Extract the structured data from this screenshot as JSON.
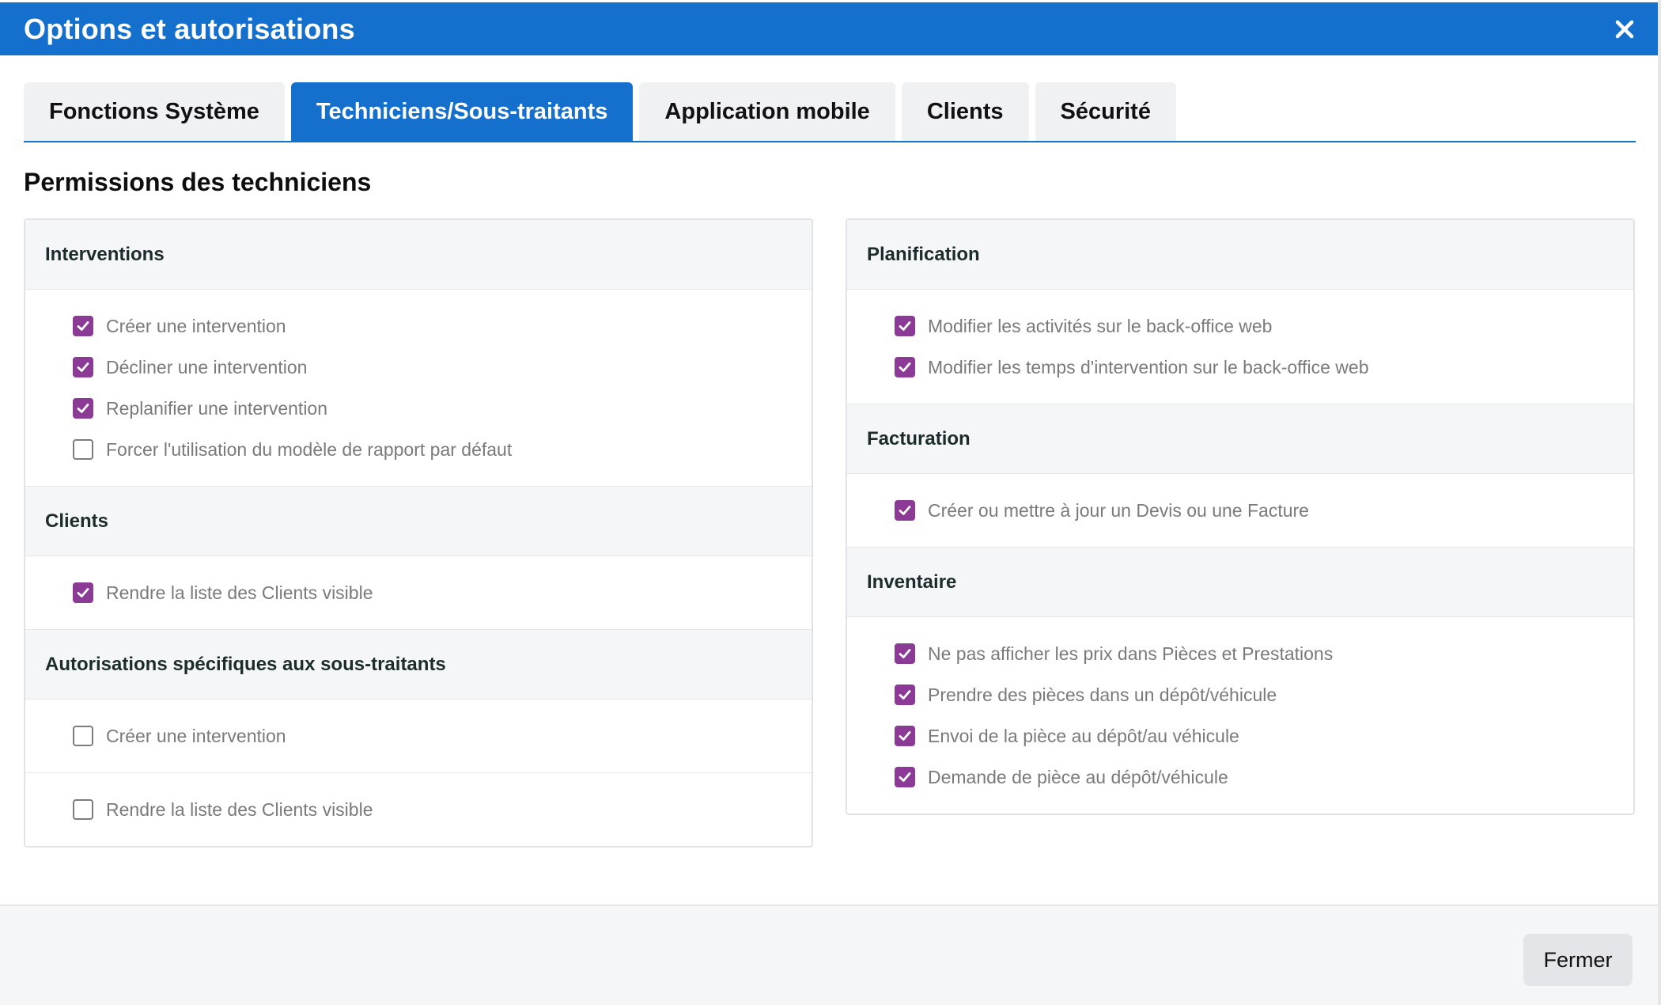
{
  "window": {
    "title": "Options et autorisations",
    "close_icon": "close-icon",
    "accent_color": "#146fcd"
  },
  "tabs": [
    {
      "label": "Fonctions Système",
      "active": false
    },
    {
      "label": "Techniciens/Sous-traitants",
      "active": true
    },
    {
      "label": "Application mobile",
      "active": false
    },
    {
      "label": "Clients",
      "active": false
    },
    {
      "label": "Sécurité",
      "active": false
    }
  ],
  "section_title": "Permissions des techniciens",
  "checkbox_checked_color": "#8b3a96",
  "left_column": {
    "interventions": {
      "title": "Interventions",
      "items": [
        {
          "label": "Créer une intervention",
          "checked": true
        },
        {
          "label": "Décliner une intervention",
          "checked": true
        },
        {
          "label": "Replanifier une intervention",
          "checked": true
        },
        {
          "label": "Forcer l'utilisation du modèle de rapport par défaut",
          "checked": false
        }
      ]
    },
    "clients": {
      "title": "Clients",
      "items": [
        {
          "label": "Rendre la liste des Clients visible",
          "checked": true
        }
      ]
    },
    "subcontractors": {
      "title": "Autorisations spécifiques aux sous-traitants",
      "items": [
        {
          "label": "Créer une intervention",
          "checked": false
        },
        {
          "label": "Rendre la liste des Clients visible",
          "checked": false
        }
      ]
    }
  },
  "right_column": {
    "planning": {
      "title": "Planification",
      "items": [
        {
          "label": "Modifier les activités sur le back-office web",
          "checked": true
        },
        {
          "label": "Modifier les temps d'intervention sur le back-office web",
          "checked": true
        }
      ]
    },
    "billing": {
      "title": "Facturation",
      "items": [
        {
          "label": "Créer ou mettre à jour un Devis ou une Facture",
          "checked": true
        }
      ]
    },
    "inventory": {
      "title": "Inventaire",
      "items": [
        {
          "label": "Ne pas afficher les prix dans Pièces et Prestations",
          "checked": true
        },
        {
          "label": "Prendre des pièces dans un dépôt/véhicule",
          "checked": true
        },
        {
          "label": "Envoi de la pièce au dépôt/au véhicule",
          "checked": true
        },
        {
          "label": "Demande de pièce au dépôt/véhicule",
          "checked": true
        }
      ]
    }
  },
  "footer": {
    "close_label": "Fermer"
  }
}
